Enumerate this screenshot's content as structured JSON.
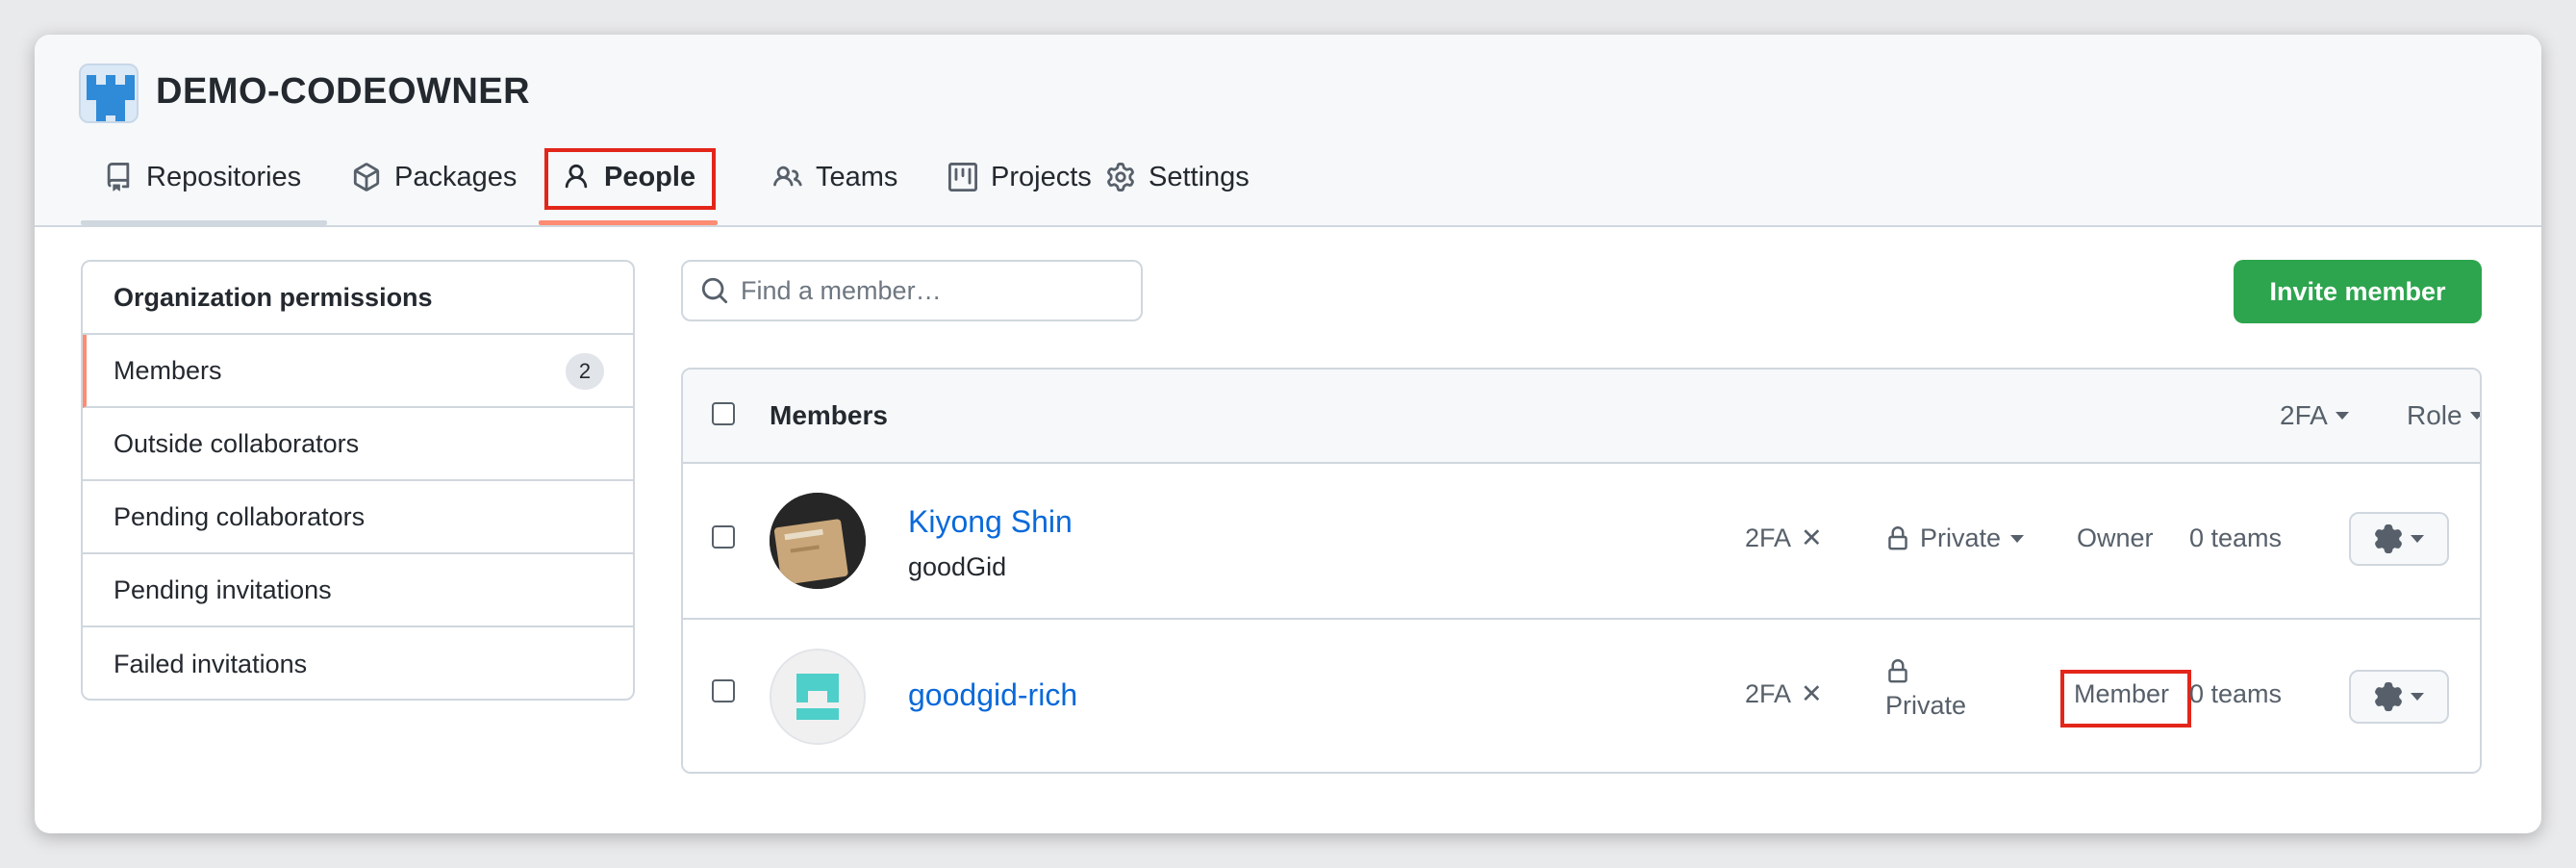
{
  "org": {
    "name": "DEMO-CODEOWNER"
  },
  "tabs": [
    {
      "label": "Repositories",
      "icon": "repo-icon"
    },
    {
      "label": "Packages",
      "icon": "package-icon"
    },
    {
      "label": "People",
      "icon": "person-icon",
      "selected": true
    },
    {
      "label": "Teams",
      "icon": "people-icon"
    },
    {
      "label": "Projects",
      "icon": "project-icon"
    },
    {
      "label": "Settings",
      "icon": "gear-icon"
    }
  ],
  "sidebar": {
    "title": "Organization permissions",
    "items": [
      {
        "label": "Members",
        "count": "2",
        "active": true
      },
      {
        "label": "Outside collaborators"
      },
      {
        "label": "Pending collaborators"
      },
      {
        "label": "Pending invitations"
      },
      {
        "label": "Failed invitations"
      }
    ]
  },
  "search": {
    "placeholder": "Find a member…"
  },
  "invite_button": "Invite member",
  "table": {
    "header": {
      "title": "Members",
      "filter_2fa": "2FA",
      "filter_role": "Role"
    },
    "rows": [
      {
        "name": "Kiyong Shin",
        "login": "goodGid",
        "twofa": "2FA",
        "twofa_status": "✕",
        "visibility": "Private",
        "role": "Owner",
        "teams": "0 teams"
      },
      {
        "name": "goodgid-rich",
        "login": "",
        "twofa": "2FA",
        "twofa_status": "✕",
        "visibility": "Private",
        "role": "Member",
        "teams": "0 teams"
      }
    ]
  },
  "colors": {
    "accent_green": "#2da44e",
    "link_blue": "#0969da",
    "highlight_red": "#e3261a",
    "tab_underline": "#fd8c73"
  }
}
